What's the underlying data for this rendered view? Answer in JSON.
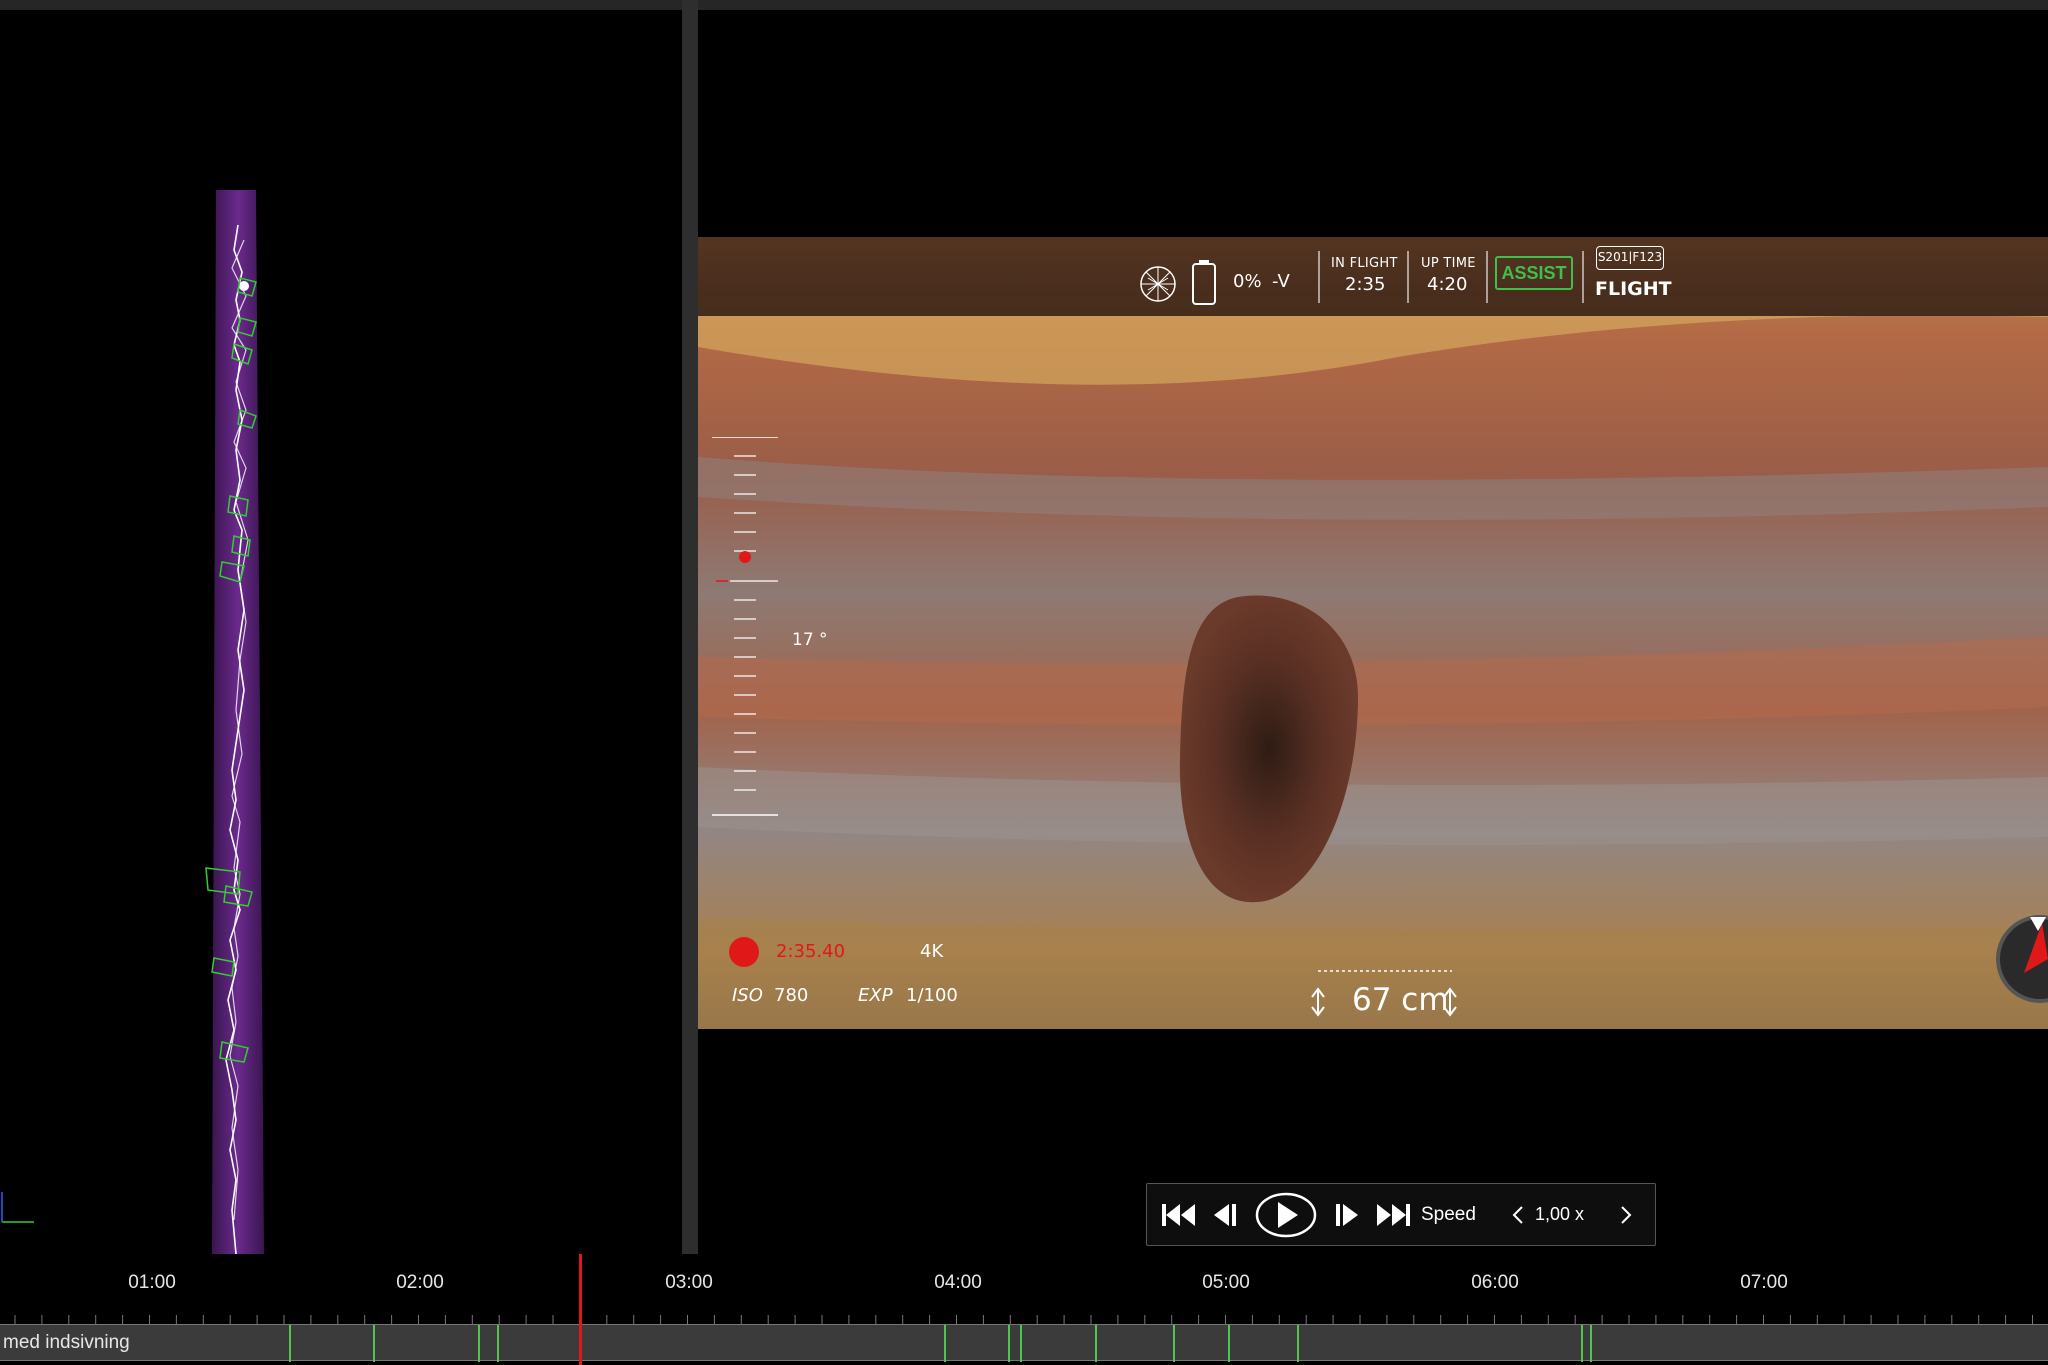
{
  "hud": {
    "battery_percent": "0%",
    "battery_voltage": "-V",
    "in_flight_label": "IN FLIGHT",
    "in_flight_value": "2:35",
    "up_time_label": "UP TIME",
    "up_time_value": "4:20",
    "assist_label": "ASSIST",
    "mission_id": "S201|F123",
    "mode_label": "FLIGHT",
    "pitch": "17 °",
    "record_time": "2:35.40",
    "resolution": "4K",
    "iso_label": "ISO",
    "iso_value": "780",
    "exp_label": "EXP",
    "exp_value": "1/100",
    "distance": "67 cm"
  },
  "controls": {
    "speed_label": "Speed",
    "speed_value": "1,00 x"
  },
  "timeline": {
    "labels": [
      "01:00",
      "02:00",
      "03:00",
      "04:00",
      "05:00",
      "06:00",
      "07:00"
    ],
    "track_label": "med indsivning"
  },
  "colors": {
    "accent_green": "#3fbf4b",
    "record_red": "#e01818",
    "path_purple": "#6a2a8c"
  }
}
